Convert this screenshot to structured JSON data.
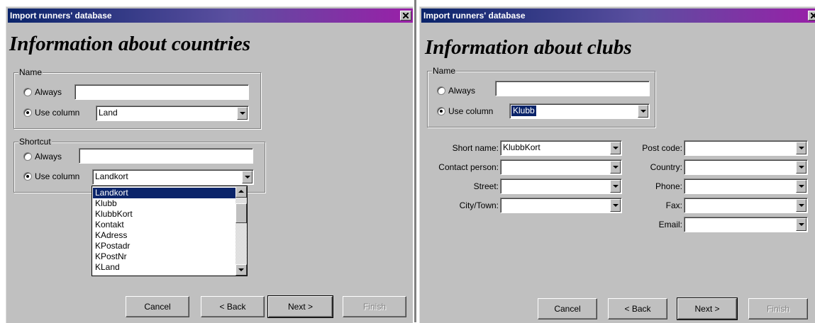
{
  "dialog_left": {
    "title": "Import runners' database",
    "heading": "Information about countries",
    "name_group": {
      "label": "Name",
      "always_label": "Always",
      "always_value": "",
      "use_column_label": "Use column",
      "use_column_value": "Land",
      "selected_option": "use_column"
    },
    "shortcut_group": {
      "label": "Shortcut",
      "always_label": "Always",
      "always_value": "",
      "use_column_label": "Use column",
      "use_column_value": "Landkort",
      "selected_option": "use_column",
      "dropdown_open": true,
      "dropdown_items": [
        "Landkort",
        "Klubb",
        "KlubbKort",
        "Kontakt",
        "KAdress",
        "KPostadr",
        "KPostNr",
        "KLand"
      ],
      "highlighted_item": "Landkort"
    },
    "buttons": {
      "cancel": "Cancel",
      "back": "< Back",
      "next": "Next >",
      "finish": "Finish"
    }
  },
  "dialog_right": {
    "title": "Import runners' database",
    "heading": "Information about clubs",
    "name_group": {
      "label": "Name",
      "always_label": "Always",
      "always_value": "",
      "use_column_label": "Use column",
      "use_column_value": "Klubb",
      "selected_option": "use_column"
    },
    "fields_left": [
      {
        "label": "Short name:",
        "value": "KlubbKort"
      },
      {
        "label": "Contact person:",
        "value": ""
      },
      {
        "label": "Street:",
        "value": ""
      },
      {
        "label": "City/Town:",
        "value": ""
      }
    ],
    "fields_right": [
      {
        "label": "Post code:",
        "value": ""
      },
      {
        "label": "Country:",
        "value": ""
      },
      {
        "label": "Phone:",
        "value": ""
      },
      {
        "label": "Fax:",
        "value": ""
      },
      {
        "label": "Email:",
        "value": ""
      }
    ],
    "buttons": {
      "cancel": "Cancel",
      "back": "< Back",
      "next": "Next >",
      "finish": "Finish"
    }
  },
  "colors": {
    "titlebar_start": "#0a246a",
    "titlebar_end": "#9a1fa8",
    "dialog_face": "#c0c0c0",
    "selection": "#0a246a"
  }
}
